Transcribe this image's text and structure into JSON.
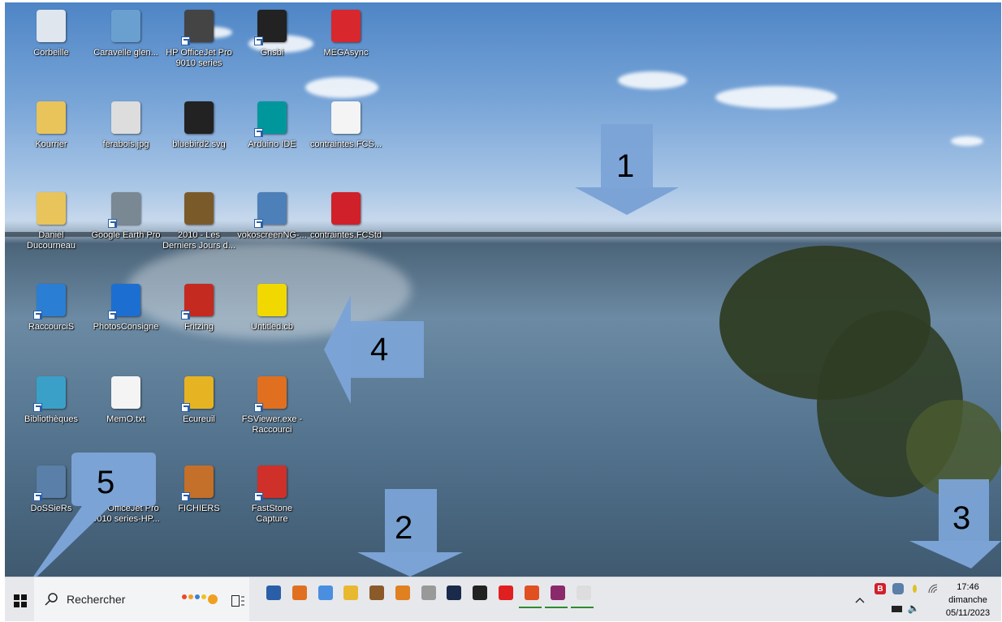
{
  "desktop": {
    "icons": [
      {
        "label": "Corbeille",
        "icon": "recycle-bin-icon",
        "color": "#dfe6ee"
      },
      {
        "label": "Caravelle glen...",
        "icon": "image-file-icon",
        "color": "#6aa0d0"
      },
      {
        "label": "HP OfficeJet Pro 9010 series",
        "icon": "printer-icon",
        "color": "#444444"
      },
      {
        "label": "Gnsbi",
        "icon": "penguin-icon",
        "color": "#222222"
      },
      {
        "label": "MEGAsync",
        "icon": "mega-icon",
        "color": "#d9272e"
      },
      {
        "label": "Kourrier",
        "icon": "folder-zip-icon",
        "color": "#e8c45a"
      },
      {
        "label": "ferabois.jpg",
        "icon": "image-file-icon",
        "color": "#dddddd"
      },
      {
        "label": "bluebird2.svg",
        "icon": "inkscape-icon",
        "color": "#222222"
      },
      {
        "label": "Arduino IDE",
        "icon": "arduino-icon",
        "color": "#00979c"
      },
      {
        "label": "contraintes.FCS...",
        "icon": "blank-file-icon",
        "color": "#f4f4f4"
      },
      {
        "label": "Daniel Ducourneau",
        "icon": "user-folder-icon",
        "color": "#e8c45a"
      },
      {
        "label": "Google Earth Pro",
        "icon": "google-earth-icon",
        "color": "#7a8894"
      },
      {
        "label": "2010 - Les Derniers Jours d...",
        "icon": "book-icon",
        "color": "#7b5a2a"
      },
      {
        "label": "vokoscreenNG-...",
        "icon": "screen-recorder-icon",
        "color": "#4d7fb8"
      },
      {
        "label": "contraintes.FCStd",
        "icon": "freecad-icon",
        "color": "#d0202a"
      },
      {
        "label": "RaccourciS",
        "icon": "shortcut-disc-icon",
        "color": "#2a7fd4"
      },
      {
        "label": "PhotosConsigne",
        "icon": "camera-icon",
        "color": "#1c6fd0"
      },
      {
        "label": "Fritzing",
        "icon": "fritzing-icon",
        "color": "#c42a20"
      },
      {
        "label": "Untitled.cb",
        "icon": "codeblocks-icon",
        "color": "#f0d800"
      },
      {
        "label": "Bibliothèques",
        "icon": "library-icon",
        "color": "#3aa0c8"
      },
      {
        "label": "MemO.txt",
        "icon": "text-file-icon",
        "color": "#f4f4f4"
      },
      {
        "label": "Ecureuil",
        "icon": "lock-icon",
        "color": "#e6b422"
      },
      {
        "label": "FSViewer.exe - Raccourci",
        "icon": "eye-icon",
        "color": "#e07020"
      },
      {
        "label": "DoSSieRs",
        "icon": "folder-box-icon",
        "color": "#5a7fa8"
      },
      {
        "label": "HP OfficeJet Pro 9010 series-HP...",
        "icon": "printer-icon",
        "color": "#444444"
      },
      {
        "label": "FICHIERS",
        "icon": "user-folder-icon",
        "color": "#c4702a"
      },
      {
        "label": "FastStone Capture",
        "icon": "faststone-icon",
        "color": "#d0302a"
      }
    ]
  },
  "annotations": [
    {
      "number": "1"
    },
    {
      "number": "2"
    },
    {
      "number": "3"
    },
    {
      "number": "4"
    },
    {
      "number": "5"
    }
  ],
  "taskbar": {
    "start_icon": "windows-start-icon",
    "search_placeholder": "Rechercher",
    "task_view_icon": "task-view-icon",
    "apps": [
      {
        "icon": "kde-app-icon",
        "color": "#2a5fa8"
      },
      {
        "icon": "search-app-icon",
        "color": "#e07020"
      },
      {
        "icon": "chrome-icon",
        "color": "#4a8ee0"
      },
      {
        "icon": "file-explorer-icon",
        "color": "#e8b830"
      },
      {
        "icon": "library-books-icon",
        "color": "#8a5a2a"
      },
      {
        "icon": "app-orange-icon",
        "color": "#e08020"
      },
      {
        "icon": "app-six-icon",
        "color": "#999999"
      },
      {
        "icon": "photo-app-icon",
        "color": "#1a2a4a"
      },
      {
        "icon": "xnview-icon",
        "color": "#222222"
      },
      {
        "icon": "youtube-icon",
        "color": "#e02020"
      },
      {
        "icon": "document-app-icon",
        "color": "#e05020"
      },
      {
        "icon": "calendar-app-icon",
        "color": "#8a2a6a"
      },
      {
        "icon": "mail-icon",
        "color": "#dddddd"
      }
    ],
    "tray": {
      "chevron_icon": "chevron-up-icon",
      "tray_icons": [
        "b-app-icon",
        "sync-icon",
        "drop-icon",
        "wifi-icon"
      ],
      "battery_icon": "battery-icon",
      "volume_icon": "volume-icon",
      "time": "17:46",
      "day": "dimanche",
      "date": "05/11/2023"
    }
  },
  "colors": {
    "arrow_fill": "#7ba3d6",
    "taskbar_bg": "#e6e8ec"
  }
}
